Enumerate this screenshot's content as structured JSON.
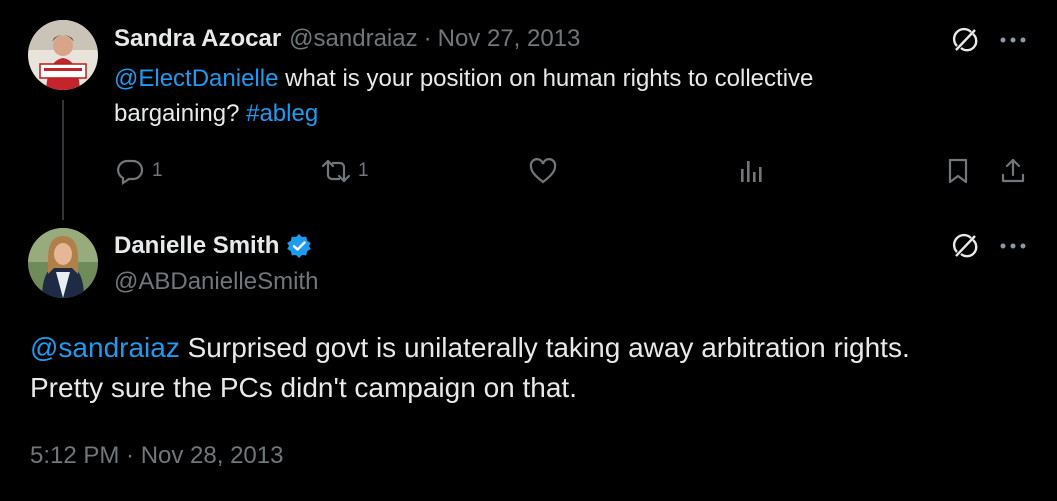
{
  "reply": {
    "author_name": "Sandra Azocar",
    "handle": "@sandraiaz",
    "separator": "·",
    "date": "Nov 27, 2013",
    "mention": "@ElectDanielle",
    "text_part1": " what is your position on human rights to collective",
    "text_part2": "bargaining? ",
    "hashtag": "#ableg",
    "reply_count": "1",
    "retweet_count": "1"
  },
  "main": {
    "author_name": "Danielle Smith",
    "handle": "@ABDanielleSmith",
    "mention": "@sandraiaz",
    "text_part1": " Surprised govt is unilaterally taking away arbitration rights.",
    "text_part2": "Pretty sure the PCs didn't campaign on that.",
    "timestamp": "5:12 PM · Nov 28, 2013"
  },
  "icons": {
    "more": "more-icon",
    "grok": "grok-icon",
    "reply": "reply-icon",
    "retweet": "retweet-icon",
    "like": "like-icon",
    "views": "views-icon",
    "bookmark": "bookmark-icon",
    "share": "share-icon",
    "verified": "verified-icon"
  },
  "colors": {
    "accent": "#1d9bf0",
    "muted": "#71767b",
    "text": "#e7e9ea",
    "background": "#000000"
  }
}
